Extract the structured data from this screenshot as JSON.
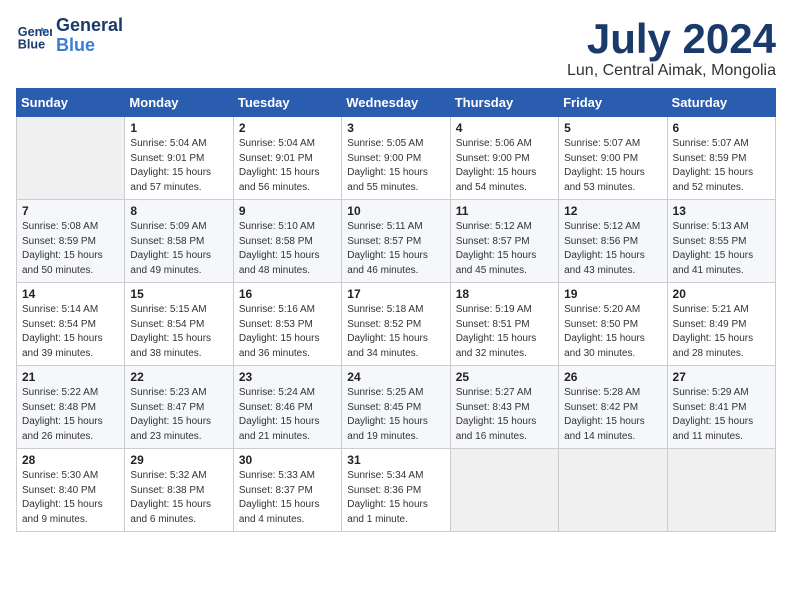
{
  "header": {
    "logo_line1": "General",
    "logo_line2": "Blue",
    "title": "July 2024",
    "subtitle": "Lun, Central Aimak, Mongolia"
  },
  "days_of_week": [
    "Sunday",
    "Monday",
    "Tuesday",
    "Wednesday",
    "Thursday",
    "Friday",
    "Saturday"
  ],
  "weeks": [
    [
      {
        "day": "",
        "info": ""
      },
      {
        "day": "1",
        "info": "Sunrise: 5:04 AM\nSunset: 9:01 PM\nDaylight: 15 hours\nand 57 minutes."
      },
      {
        "day": "2",
        "info": "Sunrise: 5:04 AM\nSunset: 9:01 PM\nDaylight: 15 hours\nand 56 minutes."
      },
      {
        "day": "3",
        "info": "Sunrise: 5:05 AM\nSunset: 9:00 PM\nDaylight: 15 hours\nand 55 minutes."
      },
      {
        "day": "4",
        "info": "Sunrise: 5:06 AM\nSunset: 9:00 PM\nDaylight: 15 hours\nand 54 minutes."
      },
      {
        "day": "5",
        "info": "Sunrise: 5:07 AM\nSunset: 9:00 PM\nDaylight: 15 hours\nand 53 minutes."
      },
      {
        "day": "6",
        "info": "Sunrise: 5:07 AM\nSunset: 8:59 PM\nDaylight: 15 hours\nand 52 minutes."
      }
    ],
    [
      {
        "day": "7",
        "info": "Sunrise: 5:08 AM\nSunset: 8:59 PM\nDaylight: 15 hours\nand 50 minutes."
      },
      {
        "day": "8",
        "info": "Sunrise: 5:09 AM\nSunset: 8:58 PM\nDaylight: 15 hours\nand 49 minutes."
      },
      {
        "day": "9",
        "info": "Sunrise: 5:10 AM\nSunset: 8:58 PM\nDaylight: 15 hours\nand 48 minutes."
      },
      {
        "day": "10",
        "info": "Sunrise: 5:11 AM\nSunset: 8:57 PM\nDaylight: 15 hours\nand 46 minutes."
      },
      {
        "day": "11",
        "info": "Sunrise: 5:12 AM\nSunset: 8:57 PM\nDaylight: 15 hours\nand 45 minutes."
      },
      {
        "day": "12",
        "info": "Sunrise: 5:12 AM\nSunset: 8:56 PM\nDaylight: 15 hours\nand 43 minutes."
      },
      {
        "day": "13",
        "info": "Sunrise: 5:13 AM\nSunset: 8:55 PM\nDaylight: 15 hours\nand 41 minutes."
      }
    ],
    [
      {
        "day": "14",
        "info": "Sunrise: 5:14 AM\nSunset: 8:54 PM\nDaylight: 15 hours\nand 39 minutes."
      },
      {
        "day": "15",
        "info": "Sunrise: 5:15 AM\nSunset: 8:54 PM\nDaylight: 15 hours\nand 38 minutes."
      },
      {
        "day": "16",
        "info": "Sunrise: 5:16 AM\nSunset: 8:53 PM\nDaylight: 15 hours\nand 36 minutes."
      },
      {
        "day": "17",
        "info": "Sunrise: 5:18 AM\nSunset: 8:52 PM\nDaylight: 15 hours\nand 34 minutes."
      },
      {
        "day": "18",
        "info": "Sunrise: 5:19 AM\nSunset: 8:51 PM\nDaylight: 15 hours\nand 32 minutes."
      },
      {
        "day": "19",
        "info": "Sunrise: 5:20 AM\nSunset: 8:50 PM\nDaylight: 15 hours\nand 30 minutes."
      },
      {
        "day": "20",
        "info": "Sunrise: 5:21 AM\nSunset: 8:49 PM\nDaylight: 15 hours\nand 28 minutes."
      }
    ],
    [
      {
        "day": "21",
        "info": "Sunrise: 5:22 AM\nSunset: 8:48 PM\nDaylight: 15 hours\nand 26 minutes."
      },
      {
        "day": "22",
        "info": "Sunrise: 5:23 AM\nSunset: 8:47 PM\nDaylight: 15 hours\nand 23 minutes."
      },
      {
        "day": "23",
        "info": "Sunrise: 5:24 AM\nSunset: 8:46 PM\nDaylight: 15 hours\nand 21 minutes."
      },
      {
        "day": "24",
        "info": "Sunrise: 5:25 AM\nSunset: 8:45 PM\nDaylight: 15 hours\nand 19 minutes."
      },
      {
        "day": "25",
        "info": "Sunrise: 5:27 AM\nSunset: 8:43 PM\nDaylight: 15 hours\nand 16 minutes."
      },
      {
        "day": "26",
        "info": "Sunrise: 5:28 AM\nSunset: 8:42 PM\nDaylight: 15 hours\nand 14 minutes."
      },
      {
        "day": "27",
        "info": "Sunrise: 5:29 AM\nSunset: 8:41 PM\nDaylight: 15 hours\nand 11 minutes."
      }
    ],
    [
      {
        "day": "28",
        "info": "Sunrise: 5:30 AM\nSunset: 8:40 PM\nDaylight: 15 hours\nand 9 minutes."
      },
      {
        "day": "29",
        "info": "Sunrise: 5:32 AM\nSunset: 8:38 PM\nDaylight: 15 hours\nand 6 minutes."
      },
      {
        "day": "30",
        "info": "Sunrise: 5:33 AM\nSunset: 8:37 PM\nDaylight: 15 hours\nand 4 minutes."
      },
      {
        "day": "31",
        "info": "Sunrise: 5:34 AM\nSunset: 8:36 PM\nDaylight: 15 hours\nand 1 minute."
      },
      {
        "day": "",
        "info": ""
      },
      {
        "day": "",
        "info": ""
      },
      {
        "day": "",
        "info": ""
      }
    ]
  ]
}
